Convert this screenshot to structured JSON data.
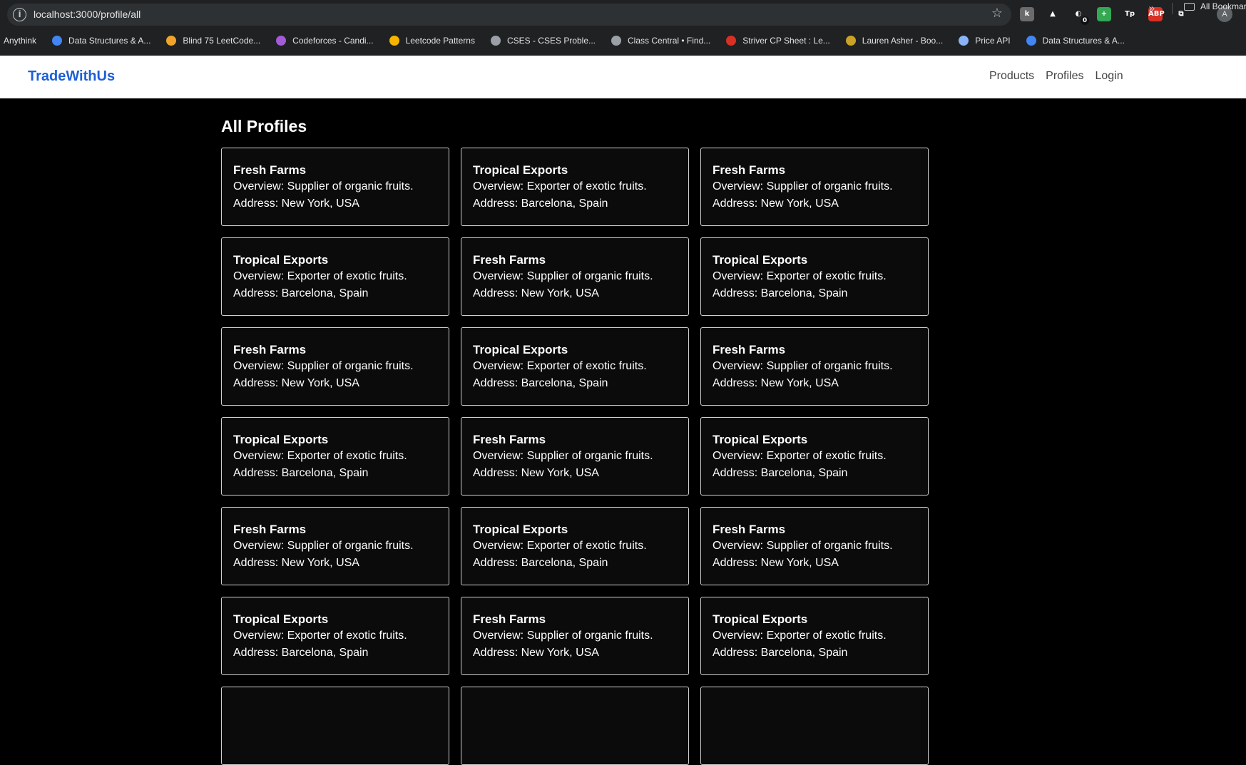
{
  "browser": {
    "url": "localhost:3000/profile/all",
    "bookmarks": [
      {
        "label": "Anythink",
        "color": ""
      },
      {
        "label": "Data Structures & A...",
        "color": "#4285f4"
      },
      {
        "label": "Blind 75 LeetCode...",
        "color": "#f0a52a"
      },
      {
        "label": "Codeforces - Candi...",
        "color": "#a35bd6"
      },
      {
        "label": "Leetcode Patterns",
        "color": "#f4b400"
      },
      {
        "label": "CSES - CSES Proble...",
        "color": "#9aa0a6"
      },
      {
        "label": "Class Central • Find...",
        "color": "#9aa0a6"
      },
      {
        "label": "Striver CP Sheet : Le...",
        "color": "#d93025"
      },
      {
        "label": "Lauren Asher - Boo...",
        "color": "#c9a227"
      },
      {
        "label": "Price API",
        "color": "#8ab4f8"
      },
      {
        "label": "Data Structures & A...",
        "color": "#4285f4"
      }
    ],
    "all_bookmarks_label": "All Bookmarks",
    "extensions": [
      {
        "icon": "k-extension-icon",
        "text": "k",
        "color": "#6b6b6b"
      },
      {
        "icon": "drive-icon",
        "text": "▲",
        "color": "#1f2123"
      },
      {
        "icon": "extension-badge-icon",
        "text": "◐",
        "color": "#1f2123",
        "badge": "0"
      },
      {
        "icon": "plus-circle-icon",
        "text": "+",
        "color": "#34a853"
      },
      {
        "icon": "tp-icon",
        "text": "Tp",
        "color": "#1f2123"
      },
      {
        "icon": "abp-icon",
        "text": "ABP",
        "color": "#d93025"
      },
      {
        "icon": "puzzle-icon",
        "text": "⧉",
        "color": "#1f2123"
      }
    ],
    "avatar": "A"
  },
  "nav": {
    "brand": "TradeWithUs",
    "links": [
      "Products",
      "Profiles",
      "Login"
    ]
  },
  "page": {
    "title": "All Profiles",
    "profiles": [
      {
        "name": "Fresh Farms",
        "overview": "Overview: Supplier of organic fruits.",
        "address": "Address: New York, USA"
      },
      {
        "name": "Tropical Exports",
        "overview": "Overview: Exporter of exotic fruits.",
        "address": "Address: Barcelona, Spain"
      },
      {
        "name": "Fresh Farms",
        "overview": "Overview: Supplier of organic fruits.",
        "address": "Address: New York, USA"
      },
      {
        "name": "Tropical Exports",
        "overview": "Overview: Exporter of exotic fruits.",
        "address": "Address: Barcelona, Spain"
      },
      {
        "name": "Fresh Farms",
        "overview": "Overview: Supplier of organic fruits.",
        "address": "Address: New York, USA"
      },
      {
        "name": "Tropical Exports",
        "overview": "Overview: Exporter of exotic fruits.",
        "address": "Address: Barcelona, Spain"
      },
      {
        "name": "Fresh Farms",
        "overview": "Overview: Supplier of organic fruits.",
        "address": "Address: New York, USA"
      },
      {
        "name": "Tropical Exports",
        "overview": "Overview: Exporter of exotic fruits.",
        "address": "Address: Barcelona, Spain"
      },
      {
        "name": "Fresh Farms",
        "overview": "Overview: Supplier of organic fruits.",
        "address": "Address: New York, USA"
      },
      {
        "name": "Tropical Exports",
        "overview": "Overview: Exporter of exotic fruits.",
        "address": "Address: Barcelona, Spain"
      },
      {
        "name": "Fresh Farms",
        "overview": "Overview: Supplier of organic fruits.",
        "address": "Address: New York, USA"
      },
      {
        "name": "Tropical Exports",
        "overview": "Overview: Exporter of exotic fruits.",
        "address": "Address: Barcelona, Spain"
      },
      {
        "name": "Fresh Farms",
        "overview": "Overview: Supplier of organic fruits.",
        "address": "Address: New York, USA"
      },
      {
        "name": "Tropical Exports",
        "overview": "Overview: Exporter of exotic fruits.",
        "address": "Address: Barcelona, Spain"
      },
      {
        "name": "Fresh Farms",
        "overview": "Overview: Supplier of organic fruits.",
        "address": "Address: New York, USA"
      },
      {
        "name": "Tropical Exports",
        "overview": "Overview: Exporter of exotic fruits.",
        "address": "Address: Barcelona, Spain"
      },
      {
        "name": "Fresh Farms",
        "overview": "Overview: Supplier of organic fruits.",
        "address": "Address: New York, USA"
      },
      {
        "name": "Tropical Exports",
        "overview": "Overview: Exporter of exotic fruits.",
        "address": "Address: Barcelona, Spain"
      },
      {
        "name": "",
        "overview": "",
        "address": ""
      },
      {
        "name": "",
        "overview": "",
        "address": ""
      },
      {
        "name": "",
        "overview": "",
        "address": ""
      }
    ]
  }
}
